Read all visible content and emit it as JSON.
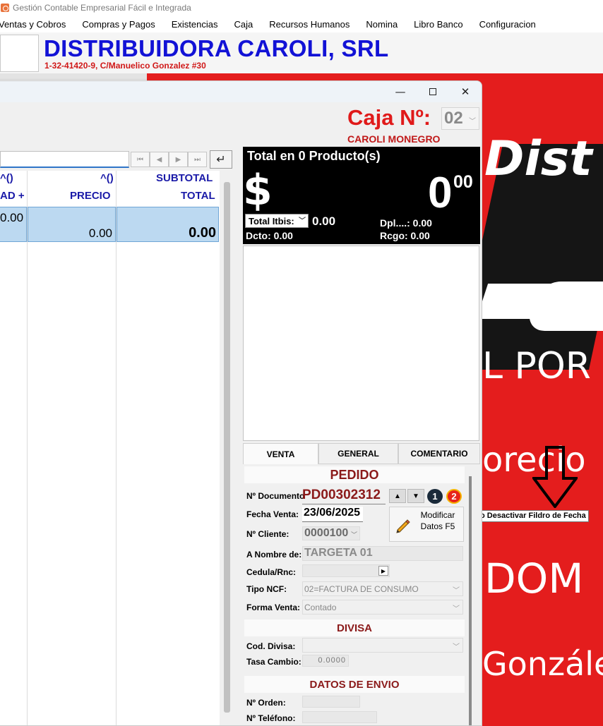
{
  "app": {
    "title": "Gestión Contable Empresarial Fácil e Integrada"
  },
  "menu": [
    "Ventas y Cobros",
    "Compras y Pagos",
    "Existencias",
    "Caja",
    "Recursos Humanos",
    "Nomina",
    "Libro Banco",
    "Configuracion"
  ],
  "company": {
    "name": "DISTRIBUIDORA CAROLI, SRL",
    "sub": "1-32-41420-9, C/Manuelico Gonzalez #30"
  },
  "banner": {
    "text1": "Dist",
    "text2": "L POR",
    "text3": "orecio",
    "text4": "DOM",
    "text5": "Gonzále",
    "tooltip": "o Desactivar Fildro de Fecha"
  },
  "window": {
    "min": "—",
    "close": "✕"
  },
  "caja": {
    "title": "Caja Nº:",
    "number": "02",
    "cashier": "CAROLI MONEGRO"
  },
  "nav": {
    "first": "⏮",
    "prev": "◀",
    "next": "▶",
    "last": "⏭",
    "enter": "↵"
  },
  "grid": {
    "headers_top": [
      "^()",
      "^()",
      "SUBTOTAL"
    ],
    "headers_bottom": [
      "AD +",
      "PRECIO",
      "TOTAL"
    ],
    "row": {
      "qty": "0.00",
      "price": "0.00",
      "total": "0.00"
    }
  },
  "totals": {
    "label": "Total en 0 Producto(s)",
    "currency": "$",
    "amount_int": "0",
    "amount_dec": "00",
    "itbis_select": "Total Itbis:",
    "itbis_value": "0.00",
    "dpl": "Dpl....: 0.00",
    "dcto": "Dcto: 0.00",
    "rcgo": "Rcgo: 0.00"
  },
  "tabs": [
    "VENTA",
    "GENERAL",
    "COMENTARIO"
  ],
  "form": {
    "pedido_header": "PEDIDO",
    "documento_label": "Nº Documento",
    "documento_value": "PD00302312",
    "page1": "1",
    "page2": "2",
    "fecha_label": "Fecha Venta:",
    "fecha_value": "23/06/2025",
    "modificar_label": "Modificar Datos F5",
    "cliente_label": "Nº Cliente:",
    "cliente_value": "0000100",
    "nombre_label": "A Nombre de:",
    "nombre_value": "TARGETA 01",
    "cedula_label": "Cedula/Rnc:",
    "ncf_label": "Tipo NCF:",
    "ncf_value": "02=FACTURA DE CONSUMO",
    "forma_label": "Forma Venta:",
    "forma_value": "Contado",
    "divisa_header": "DIVISA",
    "cod_divisa_label": "Cod. Divisa:",
    "tasa_label": "Tasa Cambio:",
    "tasa_value": "0.0000",
    "envio_header": "DATOS DE ENVIO",
    "orden_label": "Nº Orden:",
    "telefono_label": "Nº Teléfono:"
  },
  "colors": {
    "company_blue": "#1212d6",
    "accent_red": "#e01a1a",
    "section_red": "#8b1a1a",
    "grid_header_blue": "#1a1aa8",
    "banner_red": "#e41d1d"
  }
}
